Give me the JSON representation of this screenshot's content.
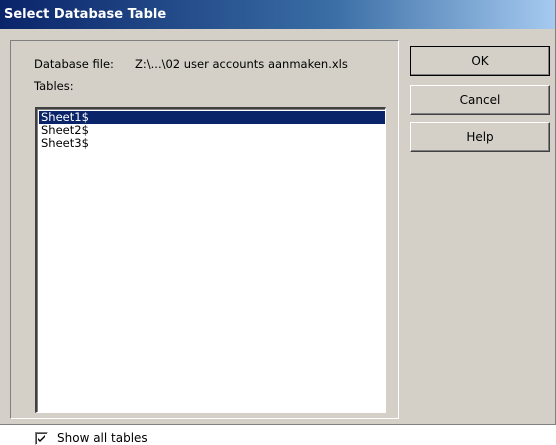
{
  "window": {
    "title": "Select Database Table"
  },
  "database_file": {
    "label": "Database file:",
    "value": "Z:\\...\\02 user accounts aanmaken.xls"
  },
  "tables": {
    "label": "Tables:",
    "items": [
      {
        "name": "Sheet1$",
        "selected": true
      },
      {
        "name": "Sheet2$",
        "selected": false
      },
      {
        "name": "Sheet3$",
        "selected": false
      }
    ]
  },
  "show_all_tables": {
    "label": "Show all tables",
    "checked": true
  },
  "buttons": {
    "ok": "OK",
    "cancel": "Cancel",
    "help": "Help"
  },
  "colors": {
    "selection": "#0a246a",
    "dialog_bg": "#d4d0c8",
    "title_gradient_start": "#0a246a",
    "title_gradient_end": "#a6caf0"
  }
}
